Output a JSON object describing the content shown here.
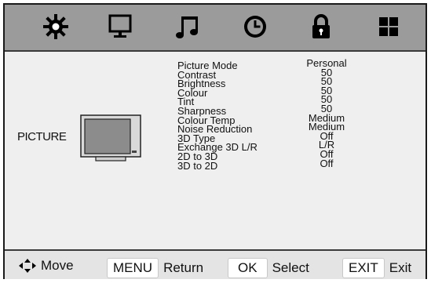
{
  "tabs": [
    {
      "icon": "gear-icon"
    },
    {
      "icon": "monitor-icon"
    },
    {
      "icon": "music-note-icon"
    },
    {
      "icon": "clock-icon"
    },
    {
      "icon": "lock-icon"
    },
    {
      "icon": "grid-icon"
    }
  ],
  "menu_title": "PICTURE",
  "settings": [
    {
      "label": "Picture Mode",
      "value": "Personal"
    },
    {
      "label": "Contrast",
      "value": "50"
    },
    {
      "label": "Brightness",
      "value": "50"
    },
    {
      "label": "Colour",
      "value": "50"
    },
    {
      "label": "Tint",
      "value": "50"
    },
    {
      "label": "Sharpness",
      "value": "50"
    },
    {
      "label": "Colour Temp",
      "value": "Medium"
    },
    {
      "label": "Noise Reduction",
      "value": "Medium"
    },
    {
      "label": "3D Type",
      "value": "Off"
    },
    {
      "label": "Exchange 3D L/R",
      "value": "L/R"
    },
    {
      "label": "2D to 3D",
      "value": "Off"
    },
    {
      "label": "3D to 2D",
      "value": "Off"
    }
  ],
  "footer": {
    "move_label": "Move",
    "menu_key": "MENU",
    "menu_label": "Return",
    "ok_key": "OK",
    "ok_label": "Select",
    "exit_key": "EXIT",
    "exit_label": "Exit"
  }
}
